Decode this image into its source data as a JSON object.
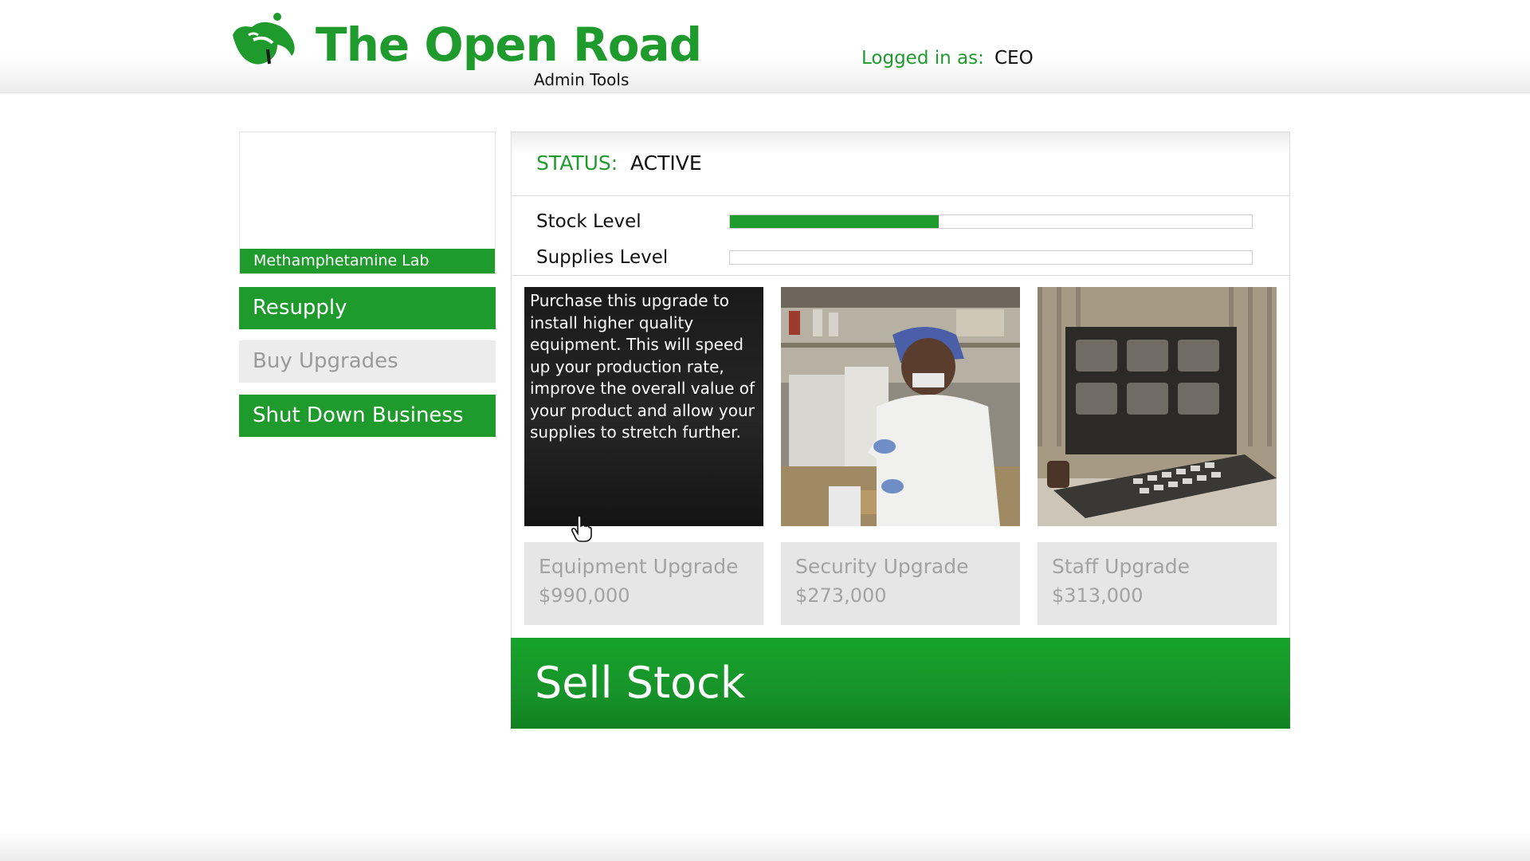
{
  "header": {
    "title": "The Open Road",
    "subtitle": "Admin Tools",
    "login_label": "Logged in as:",
    "login_user": "CEO",
    "logo_icon": "road-bird-logo-icon"
  },
  "sidebar": {
    "business_name": "Methamphetamine Lab",
    "buttons": [
      {
        "label": "Resupply",
        "state": "active"
      },
      {
        "label": "Buy Upgrades",
        "state": "disabled"
      },
      {
        "label": "Shut Down Business",
        "state": "active"
      }
    ]
  },
  "status": {
    "label": "STATUS:",
    "value": "ACTIVE"
  },
  "levels": [
    {
      "label": "Stock Level",
      "fill_fraction": 0.4
    },
    {
      "label": "Supplies Level",
      "fill_fraction": 0.0
    }
  ],
  "upgrades": [
    {
      "name": "Equipment Upgrade",
      "price": "$990,000",
      "description": "Purchase this upgrade to install higher quality equipment. This will speed up your production rate, improve the overall value of your product and allow your supplies to stretch further.",
      "image": "lab-equipment-image"
    },
    {
      "name": "Security Upgrade",
      "price": "$273,000",
      "image": "lab-worker-image"
    },
    {
      "name": "Staff Upgrade",
      "price": "$313,000",
      "image": "security-monitors-image"
    }
  ],
  "sell_button": "Sell Stock",
  "colors": {
    "accent_green": "#1f9a2d",
    "disabled_grey": "#ececec",
    "disabled_text": "#9a9a9a"
  }
}
